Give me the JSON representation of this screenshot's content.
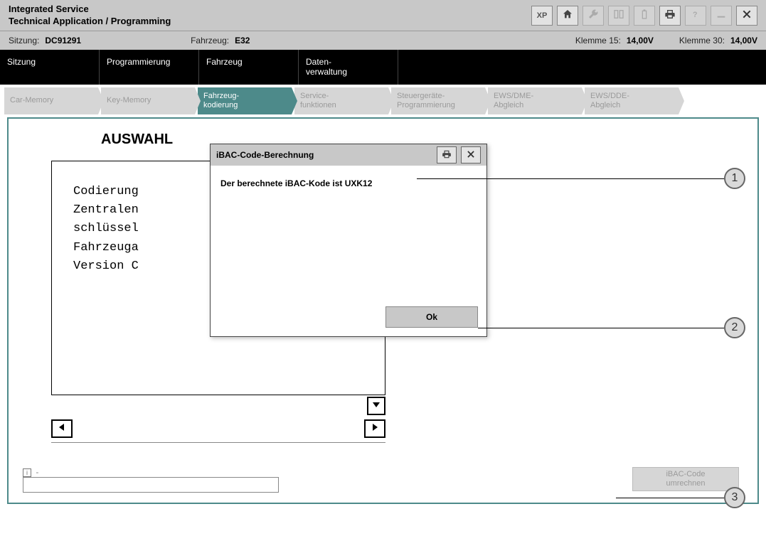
{
  "header": {
    "title_line1": "Integrated Service",
    "title_line2": "Technical Application / Programming",
    "buttons": {
      "xp": "XP"
    }
  },
  "info": {
    "sitzung_label": "Sitzung:",
    "sitzung_value": "DC91291",
    "fahrzeug_label": "Fahrzeug:",
    "fahrzeug_value": "E32",
    "klemme15_label": "Klemme 15:",
    "klemme15_value": "14,00V",
    "klemme30_label": "Klemme 30:",
    "klemme30_value": "14,00V"
  },
  "maintabs": [
    "Sitzung",
    "Programmierung",
    "Fahrzeug",
    "Daten-\nverwaltung"
  ],
  "subtabs": [
    {
      "label": "Car-Memory",
      "active": false
    },
    {
      "label": "Key-Memory",
      "active": false
    },
    {
      "label": "Fahrzeug-\nkodierung",
      "active": true
    },
    {
      "label": "Service-\nfunktionen",
      "active": false
    },
    {
      "label": "Steuergeräte-\nProgrammierung",
      "active": false
    },
    {
      "label": "EWS/DME-\nAbgleich",
      "active": false
    },
    {
      "label": "EWS/DDE-\nAbgleich",
      "active": false
    }
  ],
  "selection": {
    "title": "AUSWAHL",
    "lines": [
      "Codierung",
      "Zentralen",
      "schlüssel",
      "Fahrzeuga",
      "",
      "Version C"
    ]
  },
  "footer": {
    "dash": "-",
    "calc_button": "iBAC-Code\numrechnen"
  },
  "dialog": {
    "title": "iBAC-Code-Berechnung",
    "message": "Der berechnete iBAC-Kode ist UXK12",
    "ok": "Ok"
  },
  "callouts": {
    "c1": "1",
    "c2": "2",
    "c3": "3"
  }
}
